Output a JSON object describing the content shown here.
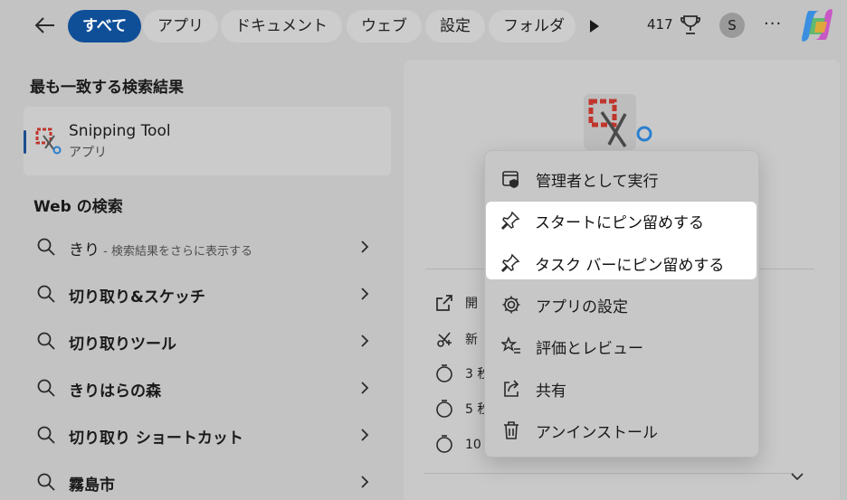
{
  "topbar": {
    "tabs": [
      "すべて",
      "アプリ",
      "ドキュメント",
      "ウェブ",
      "設定",
      "フォルダ"
    ],
    "count": "417",
    "avatar_letter": "S",
    "more": "···"
  },
  "left": {
    "best_match_heading": "最も一致する検索結果",
    "best_match": {
      "name": "Snipping Tool",
      "type": "アプリ"
    },
    "web_heading": "Web の検索",
    "web_results": [
      {
        "query": "きり",
        "hint": " - 検索結果をさらに表示する"
      },
      {
        "query": "切り取り&スケッチ",
        "hint": ""
      },
      {
        "query": "切り取りツール",
        "hint": ""
      },
      {
        "query": "きりはらの森",
        "hint": ""
      },
      {
        "query": "切り取り ショートカット",
        "hint": ""
      },
      {
        "query": "霧島市",
        "hint": ""
      }
    ]
  },
  "right": {
    "actions": [
      "開",
      "新",
      "3 秒",
      "5 秒",
      "10 秒"
    ]
  },
  "menu": {
    "items": [
      {
        "label": "管理者として実行",
        "icon": "shield-window-icon"
      },
      {
        "label": "スタートにピン留めする",
        "icon": "pin-icon"
      },
      {
        "label": "タスク バーにピン留めする",
        "icon": "pin-icon"
      },
      {
        "label": "アプリの設定",
        "icon": "gear-icon"
      },
      {
        "label": "評価とレビュー",
        "icon": "star-list-icon"
      },
      {
        "label": "共有",
        "icon": "share-icon"
      },
      {
        "label": "アンインストール",
        "icon": "trash-icon"
      }
    ]
  },
  "colors": {
    "accent": "#0f4f98",
    "overlay": "#c3c3c3",
    "highlight": "#ffffff"
  }
}
